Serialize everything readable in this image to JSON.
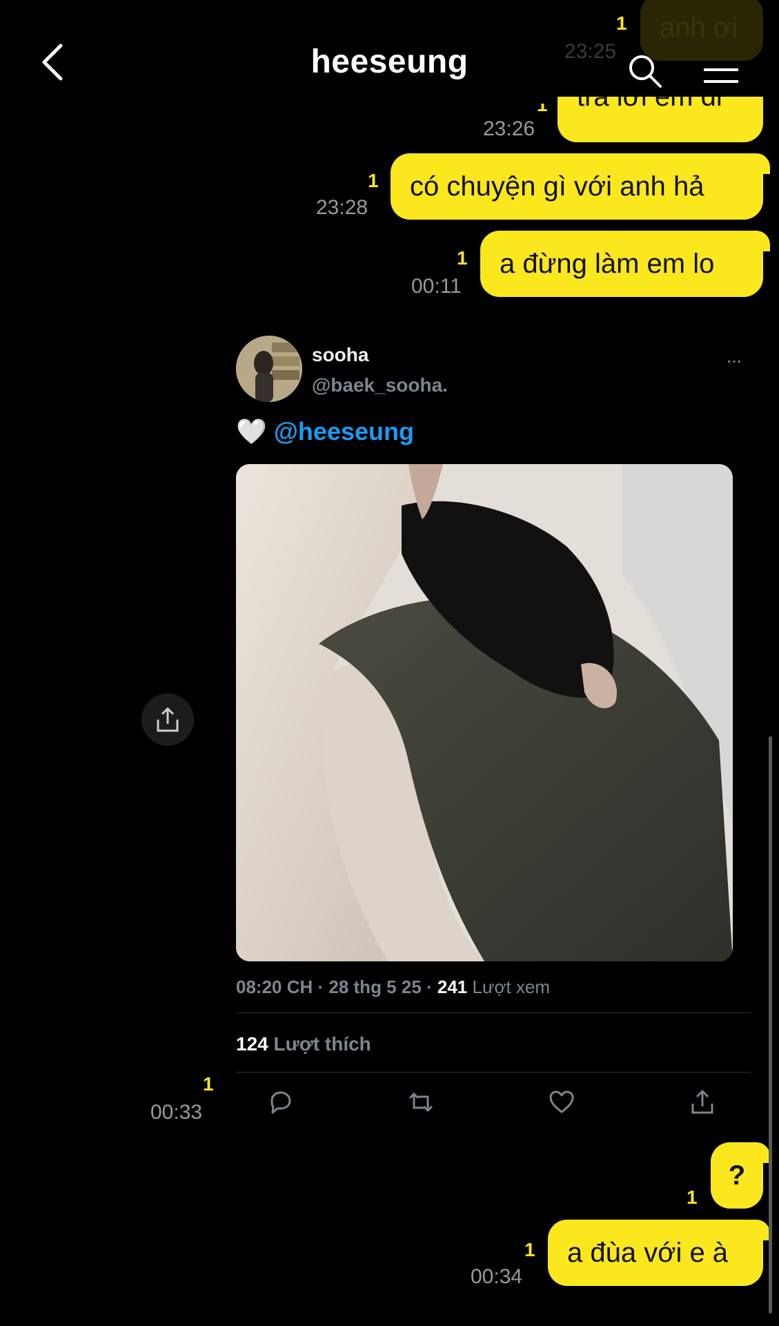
{
  "header": {
    "title": "heeseung",
    "back_icon": "chevron-left-icon",
    "search_icon": "search-icon",
    "menu_icon": "hamburger-menu-icon"
  },
  "messages": [
    {
      "text": "anh ơi",
      "unread": "1",
      "time": "23:25"
    },
    {
      "text": "trả lời em đi",
      "unread": "1",
      "time": "23:26"
    },
    {
      "text": "có chuyện gì với anh hả",
      "unread": "1",
      "time": "23:28"
    },
    {
      "text": "a đừng làm em lo",
      "unread": "1",
      "time": "00:11"
    }
  ],
  "shared_post": {
    "unread": "1",
    "time": "00:33",
    "name": "sooha",
    "handle": "@baek_sooha.",
    "more": "···",
    "heart": "🤍",
    "mention": "@heeseung",
    "meta_time": "08:20 CH · 28 thg 5 25 ·",
    "views_count": "241",
    "views_label": "Lượt xem",
    "likes_count": "124",
    "likes_label": "Lượt thích",
    "actions": [
      "reply-icon",
      "retweet-icon",
      "like-icon",
      "share-icon"
    ]
  },
  "messages_after": [
    {
      "text": "?",
      "unread": "1",
      "time": ""
    },
    {
      "text": "a đùa với e à",
      "unread": "1",
      "time": "00:34"
    }
  ],
  "colors": {
    "bubble": "#fbe71e",
    "unread": "#fbe71e",
    "mention": "#1d9bf0",
    "background": "#000000"
  }
}
